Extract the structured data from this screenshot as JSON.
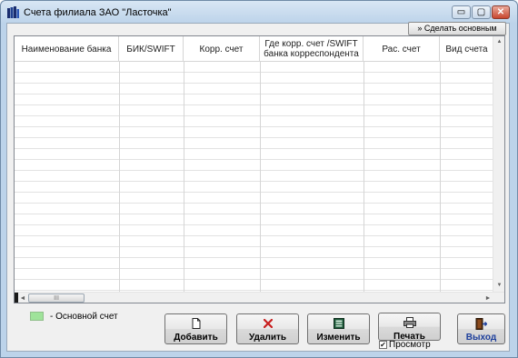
{
  "window": {
    "title": "Счета филиала ЗАО \"Ласточка\""
  },
  "titlebar_buttons": {
    "minimize": "▭",
    "maximize": "▢",
    "close": "✕"
  },
  "toolbar": {
    "make_main_label": "» Сделать основным"
  },
  "table": {
    "columns": [
      "Наименование банка",
      "БИК/SWIFT",
      "Корр. счет",
      "Где корр. счет /SWIFT банка корреспондента",
      "Рас. счет",
      "Вид счета"
    ],
    "rows": []
  },
  "scrollbar": {
    "up": "▲",
    "down": "▼",
    "left": "◄",
    "right": "►",
    "grip": "III"
  },
  "legend": {
    "label": "- Основной счет",
    "color": "#9fe39a"
  },
  "buttons": {
    "add": {
      "label": "Добавить",
      "icon": "new-document-icon"
    },
    "delete": {
      "label": "Удалить",
      "icon": "red-x-icon"
    },
    "edit": {
      "label": "Изменить",
      "icon": "edit-form-icon"
    },
    "print": {
      "label": "Печать",
      "icon": "printer-icon"
    },
    "exit": {
      "label": "Выход",
      "icon": "exit-door-icon"
    }
  },
  "preview": {
    "label": "Просмотр",
    "checked": true,
    "check": "✔"
  }
}
